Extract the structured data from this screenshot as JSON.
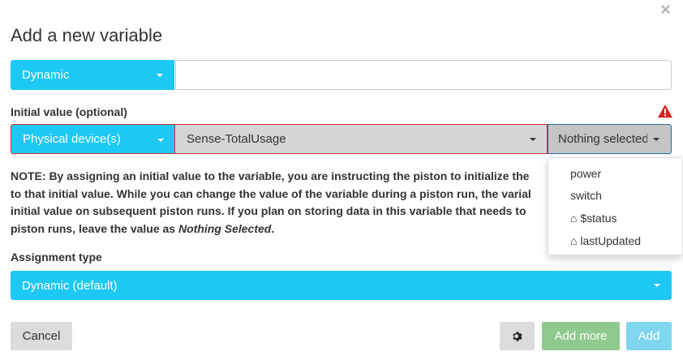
{
  "dialog": {
    "title": "Add a new variable",
    "close_label": "×"
  },
  "variable_type": {
    "selected": "Dynamic",
    "name_value": ""
  },
  "initial_value": {
    "label": "Initial value (optional)",
    "source_selected": "Physical device(s)",
    "device_selected": "Sense-TotalUsage",
    "attribute_selected": "Nothing selected",
    "attribute_options": [
      {
        "label": "power",
        "prefix": ""
      },
      {
        "label": "switch",
        "prefix": ""
      },
      {
        "label": "$status",
        "prefix": "⌂"
      },
      {
        "label": "lastUpdated",
        "prefix": "⌂"
      }
    ]
  },
  "note": {
    "line1": "NOTE: By assigning an initial value to the variable, you are instructing the piston to initialize the",
    "line2": "to that initial value. While you can change the value of the variable during a piston run, the varial",
    "line3": "initial value on subsequent piston runs. If you plan on storing data in this variable that needs to",
    "line4_prefix": "piston runs, leave the value as ",
    "line4_em": "Nothing Selected",
    "line4_suffix": "."
  },
  "assignment": {
    "label": "Assignment type",
    "selected": "Dynamic (default)"
  },
  "buttons": {
    "cancel": "Cancel",
    "add_more": "Add more",
    "add": "Add"
  },
  "colors": {
    "primary": "#1ec8f4",
    "success": "#8fc98f",
    "danger": "#c9302c"
  }
}
